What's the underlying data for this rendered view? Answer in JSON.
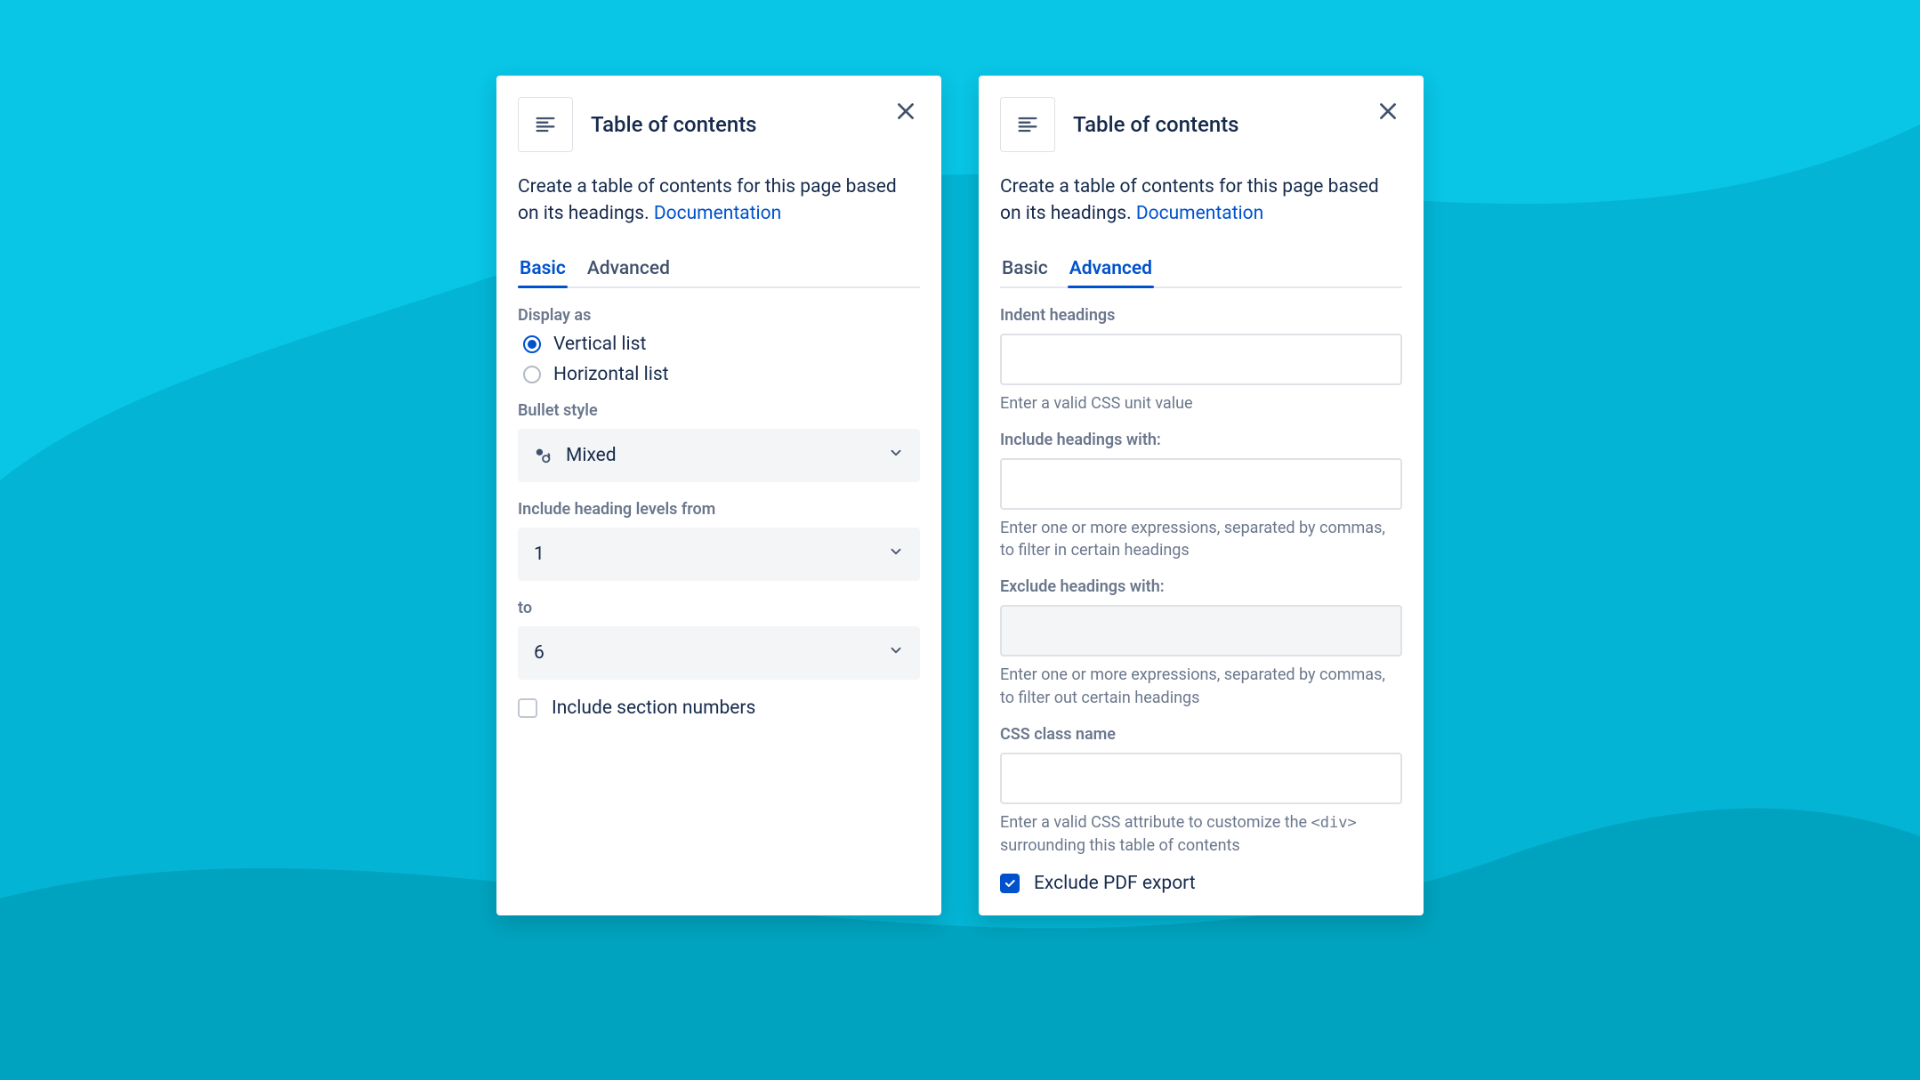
{
  "panels": {
    "basic": {
      "title": "Table of contents",
      "description_prefix": "Create a table of contents for this page based on its headings. ",
      "doc_link": "Documentation",
      "tabs": {
        "basic": "Basic",
        "advanced": "Advanced",
        "active": "basic"
      },
      "display_as": {
        "label": "Display as",
        "option_vertical": "Vertical list",
        "option_horizontal": "Horizontal list",
        "value": "vertical"
      },
      "bullet_style": {
        "label": "Bullet style",
        "value": "Mixed"
      },
      "levels": {
        "from_label": "Include heading levels from",
        "from_value": "1",
        "to_label": "to",
        "to_value": "6"
      },
      "include_section_numbers": {
        "label": "Include section numbers",
        "checked": false
      }
    },
    "advanced": {
      "title": "Table of contents",
      "description_prefix": "Create a table of contents for this page based on its headings. ",
      "doc_link": "Documentation",
      "tabs": {
        "basic": "Basic",
        "advanced": "Advanced",
        "active": "advanced"
      },
      "indent": {
        "label": "Indent headings",
        "helper": "Enter a valid CSS unit value"
      },
      "include_headings": {
        "label": "Include headings with:",
        "helper": "Enter one or more expressions, separated by commas, to filter in certain headings"
      },
      "exclude_headings": {
        "label": "Exclude headings with:",
        "helper": "Enter one or more expressions, separated by commas, to filter out certain headings"
      },
      "css_class": {
        "label": "CSS class name",
        "helper_prefix": "Enter a valid CSS attribute to customize the ",
        "helper_code": "<div>",
        "helper_suffix": " surrounding this table of contents"
      },
      "exclude_pdf": {
        "label": "Exclude PDF export",
        "checked": true
      }
    }
  }
}
